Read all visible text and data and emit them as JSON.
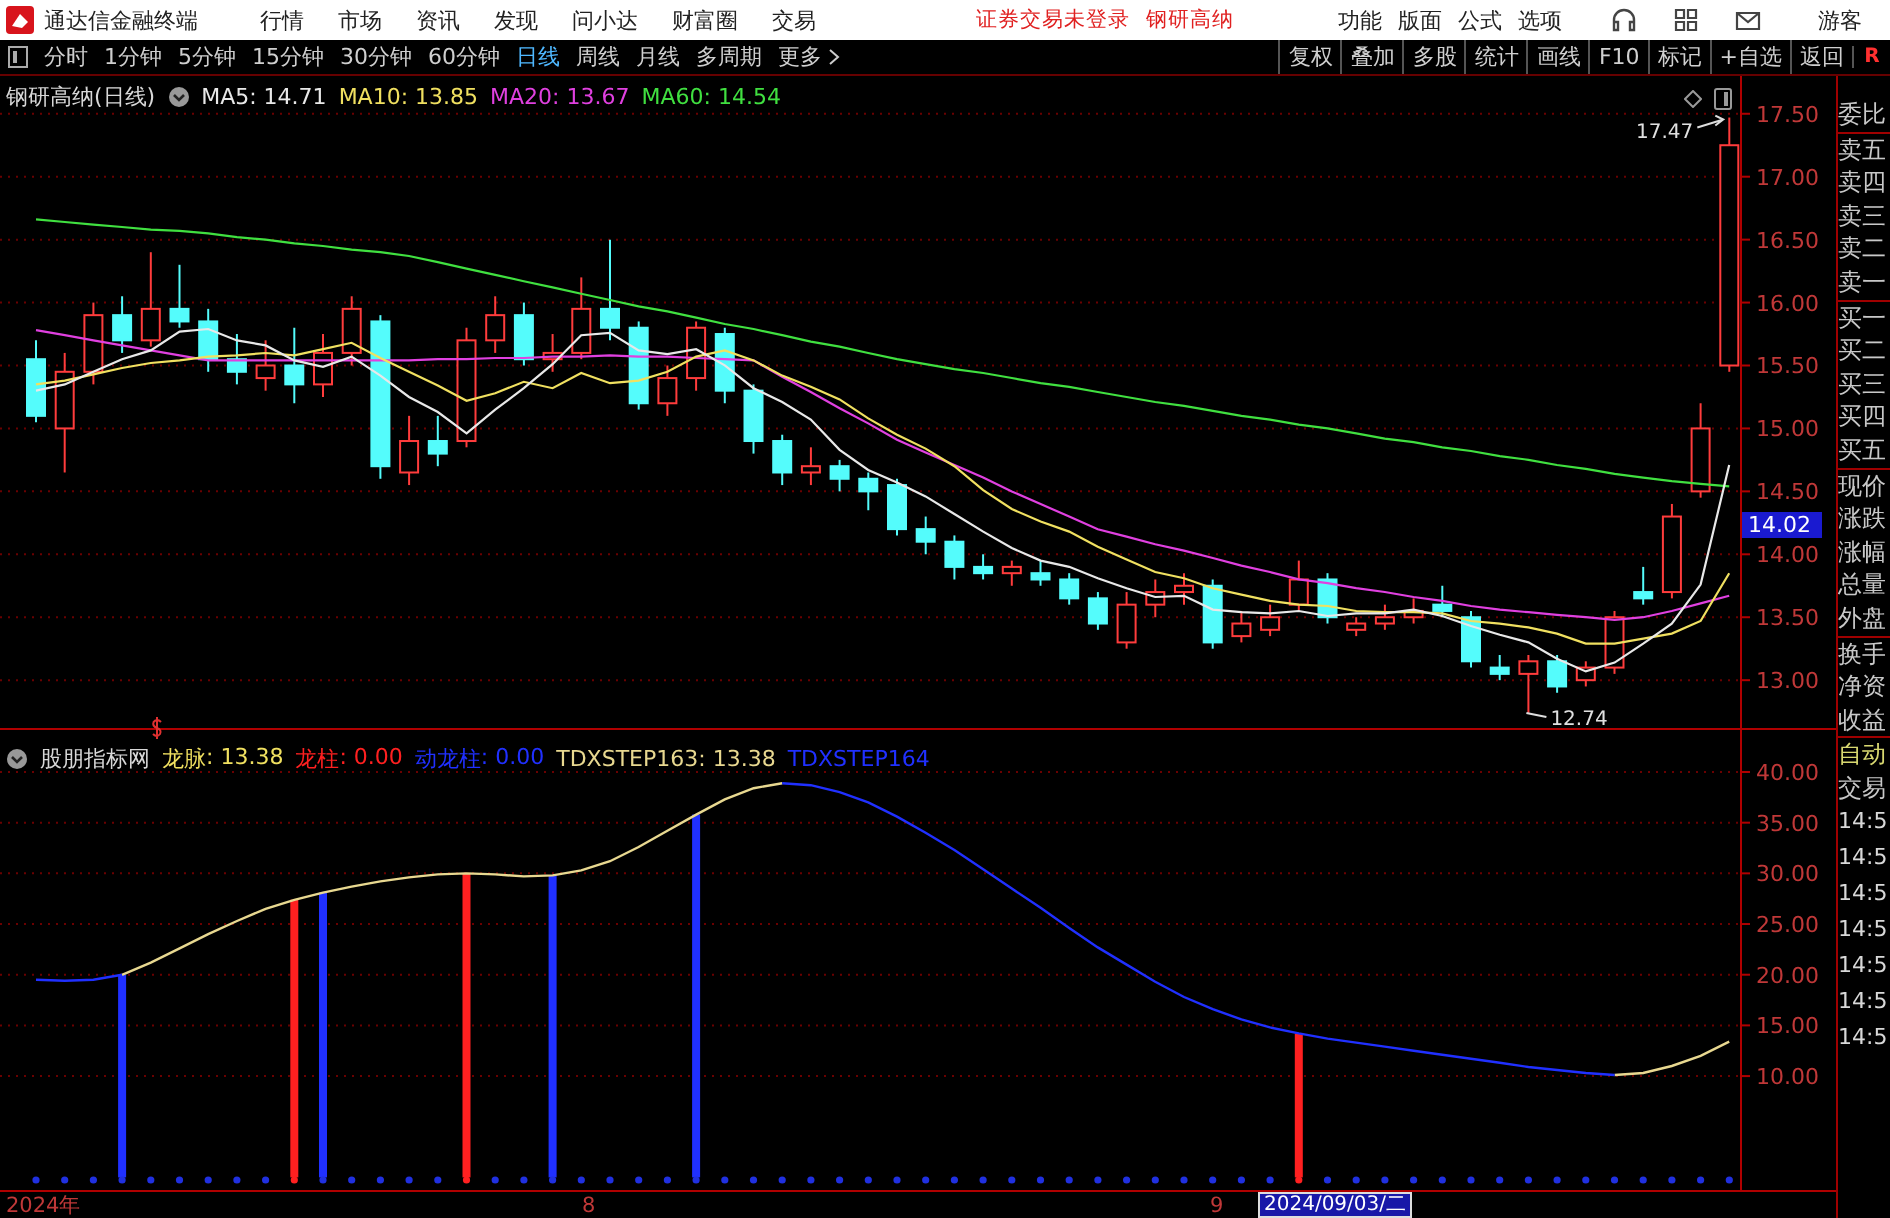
{
  "app_bar": {
    "title": "通达信金融终端",
    "menu": [
      "行情",
      "市场",
      "资讯",
      "发现",
      "问小达",
      "财富圈",
      "交易"
    ],
    "notices": [
      "证券交易未登录",
      "钢研高纳"
    ],
    "tools": [
      "功能",
      "版面",
      "公式",
      "选项"
    ],
    "user": "游客"
  },
  "toolbar": {
    "periods": [
      {
        "label": "分时",
        "selected": false
      },
      {
        "label": "1分钟",
        "selected": false
      },
      {
        "label": "5分钟",
        "selected": false
      },
      {
        "label": "15分钟",
        "selected": false
      },
      {
        "label": "30分钟",
        "selected": false
      },
      {
        "label": "60分钟",
        "selected": false
      },
      {
        "label": "日线",
        "selected": true
      },
      {
        "label": "周线",
        "selected": false
      },
      {
        "label": "月线",
        "selected": false
      },
      {
        "label": "多周期",
        "selected": false
      }
    ],
    "more": "更多",
    "buttons": [
      "复权",
      "叠加",
      "多股",
      "统计",
      "画线",
      "F10",
      "标记",
      "+自选",
      "返回"
    ],
    "corner": "R"
  },
  "main_chart": {
    "title": "钢研高纳(日线)",
    "legend": [
      {
        "value": ": 14.71"
      },
      {
        "value": ": 13.85"
      },
      {
        "value": ": 13.67"
      },
      {
        "value": ": 14.54"
      }
    ],
    "price_tag": "14.02",
    "chart_data": {
      "type": "candlestick",
      "grid": true,
      "ylim": [
        12.62,
        17.8
      ],
      "categories": [
        null,
        null,
        null,
        null,
        null,
        null,
        null,
        null,
        null,
        null,
        null,
        null,
        null,
        null,
        null,
        null,
        null,
        null,
        null,
        null,
        null,
        null,
        null,
        null,
        null,
        null,
        null,
        null,
        null,
        null,
        null,
        null,
        null,
        null,
        null,
        null,
        null,
        null,
        null,
        null,
        null,
        null,
        null,
        null,
        null,
        null,
        null,
        null,
        null,
        null,
        null,
        null,
        null,
        null,
        null,
        null,
        null,
        null,
        null,
        null
      ],
      "yticks": [
        {
          "value": 13,
          "label": "13.00"
        },
        {
          "value": 13.5,
          "label": "13.50"
        },
        {
          "value": 14,
          "label": "14.00"
        },
        {
          "value": 14.5,
          "label": "14.50"
        },
        {
          "value": 15,
          "label": "15.00"
        },
        {
          "value": 15.5,
          "label": "15.50"
        },
        {
          "value": 16,
          "label": "16.00"
        },
        {
          "value": 16.5,
          "label": "16.50"
        },
        {
          "value": 17,
          "label": "17.00"
        },
        {
          "value": 17.5,
          "label": "17.50"
        }
      ],
      "series": [
        {
          "name": "MA5",
          "type": "line",
          "color": "#e8e8e8",
          "values": [
            15.3,
            15.35,
            15.45,
            15.55,
            15.62,
            15.77,
            15.79,
            15.7,
            15.66,
            15.54,
            15.49,
            15.57,
            15.42,
            15.25,
            15.13,
            14.96,
            15.15,
            15.32,
            15.51,
            15.74,
            15.76,
            15.62,
            15.59,
            15.63,
            15.5,
            15.32,
            15.21,
            15.07,
            14.83,
            14.67,
            14.57,
            14.46,
            14.32,
            14.18,
            14.05,
            13.95,
            13.9,
            13.81,
            13.73,
            13.66,
            13.67,
            13.56,
            13.54,
            13.53,
            13.55,
            13.51,
            13.53,
            13.53,
            13.56,
            13.51,
            13.43,
            13.36,
            13.3,
            13.17,
            13.07,
            13.14,
            13.29,
            13.45,
            13.76,
            14.71
          ]
        },
        {
          "name": "MA10",
          "type": "line",
          "color": "#f0e060",
          "values": [
            15.35,
            15.38,
            15.43,
            15.48,
            15.52,
            15.54,
            15.57,
            15.58,
            15.6,
            15.58,
            15.63,
            15.68,
            15.56,
            15.45,
            15.34,
            15.22,
            15.28,
            15.37,
            15.32,
            15.44,
            15.36,
            15.38,
            15.45,
            15.57,
            15.62,
            15.54,
            15.42,
            15.33,
            15.23,
            15.08,
            14.95,
            14.84,
            14.7,
            14.51,
            14.36,
            14.26,
            14.18,
            14.06,
            13.96,
            13.86,
            13.81,
            13.73,
            13.68,
            13.63,
            13.6,
            13.59,
            13.55,
            13.54,
            13.54,
            13.53,
            13.47,
            13.45,
            13.42,
            13.37,
            13.29,
            13.29,
            13.33,
            13.37,
            13.47,
            13.85
          ]
        },
        {
          "name": "MA20",
          "type": "line",
          "color": "#e040e0",
          "values": [
            15.78,
            15.74,
            15.7,
            15.66,
            15.62,
            15.58,
            15.54,
            15.54,
            15.54,
            15.54,
            15.54,
            15.54,
            15.54,
            15.54,
            15.55,
            15.55,
            15.56,
            15.56,
            15.57,
            15.57,
            15.58,
            15.57,
            15.57,
            15.56,
            15.55,
            15.54,
            15.41,
            15.29,
            15.16,
            15.04,
            14.91,
            14.81,
            14.71,
            14.61,
            14.5,
            14.4,
            14.3,
            14.2,
            14.14,
            14.08,
            14.03,
            13.97,
            13.91,
            13.86,
            13.8,
            13.77,
            13.73,
            13.7,
            13.66,
            13.63,
            13.59,
            13.56,
            13.54,
            13.52,
            13.5,
            13.48,
            13.5,
            13.55,
            13.61,
            13.67
          ]
        },
        {
          "name": "MA60",
          "type": "line",
          "color": "#40e040",
          "values": [
            16.66,
            16.64,
            16.62,
            16.6,
            16.58,
            16.57,
            16.55,
            16.52,
            16.5,
            16.47,
            16.45,
            16.42,
            16.4,
            16.37,
            16.32,
            16.27,
            16.22,
            16.17,
            16.12,
            16.07,
            16.02,
            15.97,
            15.93,
            15.88,
            15.83,
            15.79,
            15.74,
            15.69,
            15.65,
            15.6,
            15.55,
            15.51,
            15.47,
            15.44,
            15.4,
            15.36,
            15.33,
            15.29,
            15.25,
            15.21,
            15.18,
            15.14,
            15.1,
            15.07,
            15.03,
            15.0,
            14.96,
            14.92,
            14.89,
            14.85,
            14.82,
            14.78,
            14.75,
            14.71,
            14.68,
            14.64,
            14.61,
            14.58,
            14.56,
            14.54
          ]
        }
      ],
      "ohlc": [
        [
          15.55,
          15.7,
          15.05,
          15.1
        ],
        [
          15.0,
          15.6,
          14.65,
          15.45
        ],
        [
          15.45,
          16.0,
          15.35,
          15.9
        ],
        [
          15.9,
          16.05,
          15.6,
          15.7
        ],
        [
          15.7,
          16.4,
          15.65,
          15.95
        ],
        [
          15.95,
          16.3,
          15.8,
          15.85
        ],
        [
          15.85,
          15.95,
          15.45,
          15.55
        ],
        [
          15.55,
          15.75,
          15.35,
          15.45
        ],
        [
          15.4,
          15.7,
          15.3,
          15.5
        ],
        [
          15.5,
          15.8,
          15.2,
          15.35
        ],
        [
          15.35,
          15.75,
          15.25,
          15.6
        ],
        [
          15.6,
          16.05,
          15.5,
          15.95
        ],
        [
          15.85,
          15.9,
          14.6,
          14.7
        ],
        [
          14.65,
          15.1,
          14.55,
          14.9
        ],
        [
          14.9,
          15.1,
          14.7,
          14.8
        ],
        [
          14.9,
          15.8,
          14.85,
          15.7
        ],
        [
          15.7,
          16.05,
          15.6,
          15.9
        ],
        [
          15.9,
          16.0,
          15.5,
          15.55
        ],
        [
          15.55,
          15.75,
          15.45,
          15.6
        ],
        [
          15.6,
          16.2,
          15.55,
          15.95
        ],
        [
          15.95,
          16.5,
          15.7,
          15.8
        ],
        [
          15.8,
          15.85,
          15.15,
          15.2
        ],
        [
          15.2,
          15.5,
          15.1,
          15.4
        ],
        [
          15.4,
          15.85,
          15.3,
          15.8
        ],
        [
          15.75,
          15.8,
          15.2,
          15.3
        ],
        [
          15.3,
          15.35,
          14.8,
          14.9
        ],
        [
          14.9,
          14.95,
          14.55,
          14.65
        ],
        [
          14.65,
          14.85,
          14.55,
          14.7
        ],
        [
          14.7,
          14.75,
          14.5,
          14.6
        ],
        [
          14.6,
          14.65,
          14.35,
          14.5
        ],
        [
          14.55,
          14.6,
          14.15,
          14.2
        ],
        [
          14.2,
          14.3,
          14.0,
          14.1
        ],
        [
          14.1,
          14.15,
          13.8,
          13.9
        ],
        [
          13.9,
          14.0,
          13.8,
          13.85
        ],
        [
          13.85,
          13.95,
          13.75,
          13.9
        ],
        [
          13.85,
          13.95,
          13.75,
          13.8
        ],
        [
          13.8,
          13.85,
          13.6,
          13.65
        ],
        [
          13.65,
          13.7,
          13.4,
          13.45
        ],
        [
          13.3,
          13.7,
          13.25,
          13.6
        ],
        [
          13.6,
          13.8,
          13.5,
          13.7
        ],
        [
          13.7,
          13.85,
          13.6,
          13.75
        ],
        [
          13.75,
          13.8,
          13.25,
          13.3
        ],
        [
          13.35,
          13.55,
          13.3,
          13.45
        ],
        [
          13.4,
          13.6,
          13.35,
          13.5
        ],
        [
          13.6,
          13.95,
          13.55,
          13.8
        ],
        [
          13.8,
          13.85,
          13.45,
          13.5
        ],
        [
          13.4,
          13.5,
          13.35,
          13.45
        ],
        [
          13.45,
          13.6,
          13.4,
          13.5
        ],
        [
          13.5,
          13.65,
          13.45,
          13.55
        ],
        [
          13.6,
          13.75,
          13.5,
          13.55
        ],
        [
          13.5,
          13.55,
          13.1,
          13.15
        ],
        [
          13.1,
          13.2,
          13.0,
          13.05
        ],
        [
          13.05,
          13.2,
          12.74,
          13.15
        ],
        [
          13.15,
          13.2,
          12.9,
          12.95
        ],
        [
          13.0,
          13.15,
          12.95,
          13.1
        ],
        [
          13.1,
          13.55,
          13.05,
          13.5
        ],
        [
          13.7,
          13.9,
          13.6,
          13.65
        ],
        [
          13.7,
          14.4,
          13.65,
          14.3
        ],
        [
          14.5,
          15.2,
          14.45,
          15.0
        ],
        [
          15.5,
          17.47,
          15.45,
          17.25
        ]
      ],
      "annotations": [
        {
          "text": "17.47"
        },
        {
          "text": "12.74"
        }
      ]
    }
  },
  "indicator_panel": {
    "title": "股朋指标网",
    "lead": {
      "label": "龙脉",
      "value": ": 13.38",
      "color": "#f0e060"
    },
    "readings": [
      ": 0.00",
      ": 0.00",
      ": 13.38"
    ],
    "chart_data": {
      "type": "line",
      "grid": true,
      "ylim": [
        -1.24,
        44.34
      ],
      "yticks": [
        {
          "value": 10,
          "label": "10.00"
        },
        {
          "value": 15,
          "label": "15.00"
        },
        {
          "value": 20,
          "label": "20.00"
        },
        {
          "value": 25,
          "label": "25.00"
        },
        {
          "value": 30,
          "label": "30.00"
        },
        {
          "value": 35,
          "label": "35.00"
        },
        {
          "value": 40,
          "label": "40.00"
        }
      ],
      "series": [
        {
          "name": "龙柱",
          "type": "bar",
          "color": "#ff2020",
          "values": [
            null,
            null,
            null,
            null,
            null,
            null,
            null,
            null,
            null,
            27.4,
            null,
            null,
            null,
            null,
            null,
            30,
            null,
            null,
            null,
            null,
            null,
            null,
            null,
            null,
            null,
            null,
            null,
            null,
            null,
            null,
            null,
            null,
            null,
            null,
            null,
            null,
            null,
            null,
            null,
            null,
            null,
            null,
            null,
            null,
            14.2,
            null,
            null,
            null,
            null,
            null,
            null,
            null,
            null,
            null,
            null,
            null,
            null,
            null,
            null,
            null
          ]
        },
        {
          "name": "动龙柱",
          "type": "bar",
          "color": "#2030ff",
          "values": [
            null,
            null,
            null,
            20,
            null,
            null,
            null,
            null,
            null,
            null,
            28.1,
            null,
            null,
            null,
            null,
            null,
            null,
            null,
            29.8,
            null,
            null,
            null,
            null,
            35.8,
            null,
            null,
            null,
            null,
            null,
            null,
            null,
            null,
            null,
            null,
            null,
            null,
            null,
            null,
            null,
            null,
            null,
            null,
            null,
            null,
            null,
            null,
            null,
            null,
            null,
            null,
            null,
            null,
            null,
            null,
            null,
            null,
            null,
            null,
            null,
            null
          ]
        },
        {
          "name": "TDXSTEP163",
          "type": "line",
          "color": "#e8d890",
          "values": [
            null,
            null,
            null,
            20,
            21.2,
            22.6,
            24,
            25.3,
            26.5,
            27.4,
            28.1,
            28.7,
            29.2,
            29.6,
            29.9,
            30,
            29.9,
            29.7,
            29.8,
            30.3,
            31.2,
            32.6,
            34.2,
            35.8,
            37.3,
            38.4,
            38.9,
            null,
            null,
            null,
            null,
            null,
            null,
            null,
            null,
            null,
            null,
            null,
            null,
            null,
            null,
            null,
            null,
            null,
            null,
            null,
            null,
            null,
            null,
            null,
            null,
            null,
            null,
            null,
            null,
            10.1,
            10.3,
            11,
            12,
            13.4
          ]
        },
        {
          "name": "TDXSTEP164",
          "type": "line",
          "color": "#2030ff",
          "values": [
            19.5,
            19.4,
            19.5,
            20,
            null,
            null,
            null,
            null,
            null,
            null,
            null,
            null,
            null,
            null,
            null,
            null,
            null,
            null,
            null,
            null,
            null,
            null,
            null,
            null,
            null,
            null,
            38.9,
            38.7,
            38,
            37,
            35.6,
            34,
            32.3,
            30.4,
            28.5,
            26.6,
            24.6,
            22.7,
            21,
            19.3,
            17.8,
            16.6,
            15.6,
            14.8,
            14.2,
            13.7,
            13.3,
            12.9,
            12.5,
            12.1,
            11.7,
            11.3,
            10.9,
            10.6,
            10.3,
            10.1,
            null,
            null,
            null,
            null
          ]
        }
      ]
    },
    "x_axis": {
      "labels": [
        "2024年",
        "8",
        "9"
      ],
      "cursor": "2024/09/03/二"
    }
  },
  "side_panel": {
    "groups": [
      [
        "委比"
      ],
      [
        "卖五",
        "卖四",
        "卖三",
        "卖二",
        "卖一"
      ],
      [
        "买一",
        "买二",
        "买三",
        "买四",
        "买五"
      ],
      [
        "现价",
        "涨跌",
        "涨幅",
        "总量",
        "外盘"
      ],
      [
        "换手",
        "净资",
        "收益"
      ]
    ],
    "auto": "自动",
    "trade": "交易",
    "times": [
      "14:5",
      "14:5",
      "14:5",
      "14:5",
      "14:5",
      "14:5",
      "14:5"
    ]
  }
}
